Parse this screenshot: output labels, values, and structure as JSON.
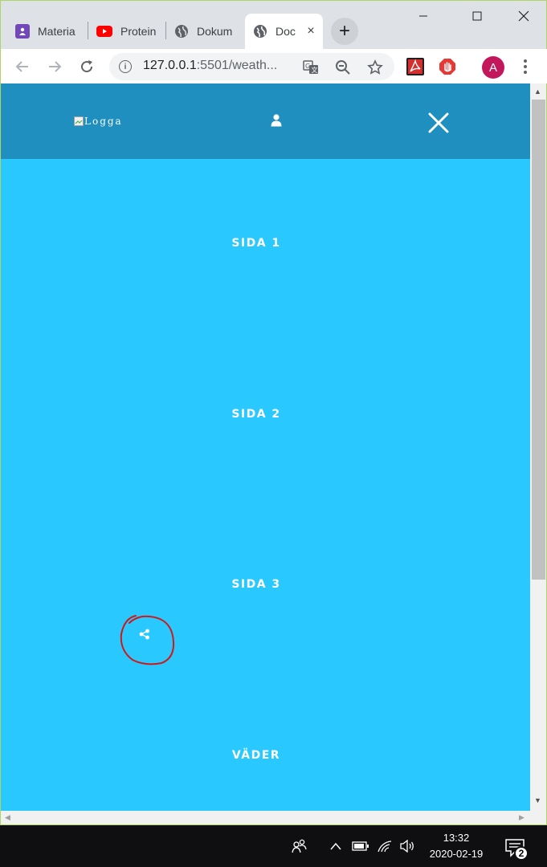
{
  "browser": {
    "tabs": [
      {
        "title": "Materia",
        "icon": "classroom-icon",
        "color": "#7248b9"
      },
      {
        "title": "Protein",
        "icon": "youtube-icon",
        "color": "#ff0000"
      },
      {
        "title": "Dokum",
        "icon": "globe-icon",
        "color": "#5f6368"
      },
      {
        "title": "Doc",
        "icon": "globe-icon",
        "color": "#5f6368"
      }
    ],
    "active_tab_close": "×",
    "new_tab": "+",
    "url_host": "127.0.0.1",
    "url_rest": ":5501/weath...",
    "avatar_letter": "A"
  },
  "site": {
    "logo_alt": "Logga",
    "menu": [
      {
        "label": "SIDA 1"
      },
      {
        "label": "SIDA 2"
      },
      {
        "label": "SIDA 3"
      },
      {
        "label": "VÄDER"
      }
    ],
    "colors": {
      "header": "#1e8fbf",
      "menu_bg": "#29c9ff",
      "annotation": "#d01818"
    }
  },
  "taskbar": {
    "time": "13:32",
    "date": "2020-02-19",
    "notification_count": "2"
  }
}
